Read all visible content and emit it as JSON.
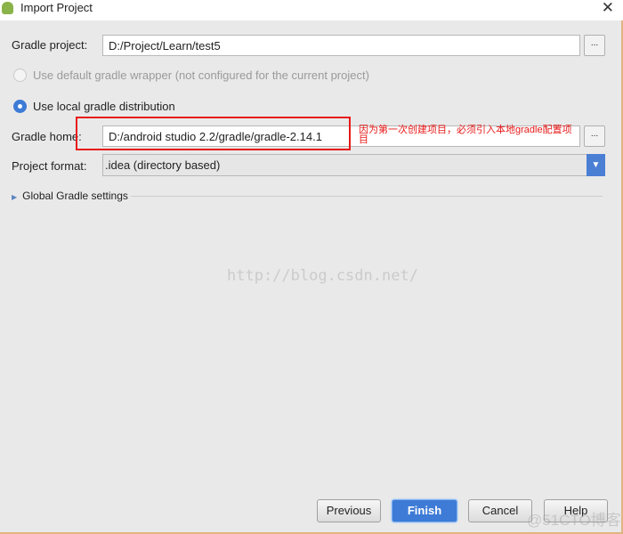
{
  "window": {
    "title": "Import Project",
    "close_icon": "close-icon"
  },
  "form": {
    "gradle_project_label": "Gradle project:",
    "gradle_project_value": "D:/Project/Learn/test5",
    "browse_label": "...",
    "radio_default": "Use default gradle wrapper (not configured for the current project)",
    "radio_local": "Use local gradle distribution",
    "selected_option": "Use local gradle distribution",
    "gradle_home_label": "Gradle home:",
    "gradle_home_value": "D:/android studio 2.2/gradle/gradle-2.14.1",
    "project_format_label": "Project format:",
    "project_format_value": ".idea (directory based)",
    "global_settings": "Global Gradle settings"
  },
  "annotation": {
    "text": "因为第一次创建项目，必须引入本地gradle配置项目",
    "color": "#e81818"
  },
  "watermarks": {
    "center": "http://blog.csdn.net/",
    "corner": "@51CTO博客"
  },
  "buttons": {
    "previous": "Previous",
    "finish": "Finish",
    "cancel": "Cancel",
    "help": "Help"
  },
  "colors": {
    "accent": "#3d7bd6",
    "annotation": "#e81818"
  }
}
